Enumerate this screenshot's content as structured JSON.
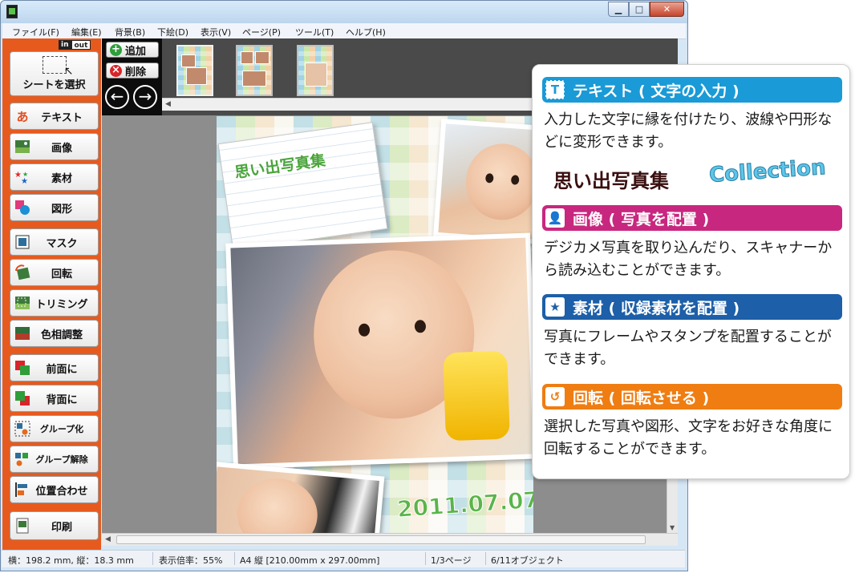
{
  "window": {
    "min_label": "▁",
    "max_label": "□",
    "close_label": "✕"
  },
  "menu": [
    "ファイル(F)",
    "編集(E)",
    "背景(B)",
    "下絵(D)",
    "表示(V)",
    "ページ(P)",
    "ツール(T)",
    "ヘルプ(H)"
  ],
  "inout": {
    "in": "in",
    "out": "out"
  },
  "tools": {
    "select": "シートを選択",
    "text": "テキスト",
    "text_icon": "あ",
    "image": "画像",
    "material": "素材",
    "shape": "図形",
    "mask": "マスク",
    "rotate": "回転",
    "trim": "トリミング",
    "color": "色相調整",
    "front": "前面に",
    "back": "背面に",
    "group": "グループ化",
    "ungroup": "グループ解除",
    "align": "位置合わせ",
    "print": "印刷"
  },
  "pages": {
    "add": "追加",
    "delete": "削除",
    "add_icon": "+",
    "delete_icon": "×",
    "prev_icon": "←",
    "next_icon": "→"
  },
  "canvas_page": {
    "note_title": "思い出写真集",
    "date": "2011.07.07"
  },
  "status": {
    "coords": "横：198.2 mm, 縦：18.3 mm",
    "zoom": "表示倍率：55%",
    "paper": "A4 縦 [210.00mm x 297.00mm]",
    "page": "1/3ページ",
    "objects": "6/11オブジェクト"
  },
  "callout": {
    "text": {
      "title": "テキスト ( 文字の入力 )",
      "icon": "T",
      "color": "#1a9ad6",
      "desc": "入力した文字に縁を付けたり、波線や円形などに変形できます。",
      "sample_jp": "思い出写真集",
      "sample_en": "Collection"
    },
    "image": {
      "title": "画像 ( 写真を配置 )",
      "icon": "👤",
      "color": "#c8277f",
      "desc": "デジカメ写真を取り込んだり、スキャナーから読み込むことができます。"
    },
    "material": {
      "title": "素材 ( 収録素材を配置 )",
      "icon": "★",
      "color": "#1d5fa8",
      "desc": "写真にフレームやスタンプを配置することができます。"
    },
    "rotate": {
      "title": "回転 ( 回転させる )",
      "icon": "↺",
      "color": "#ef7d12",
      "desc": "選択した写真や図形、文字をお好きな角度に回転することができます。"
    }
  }
}
